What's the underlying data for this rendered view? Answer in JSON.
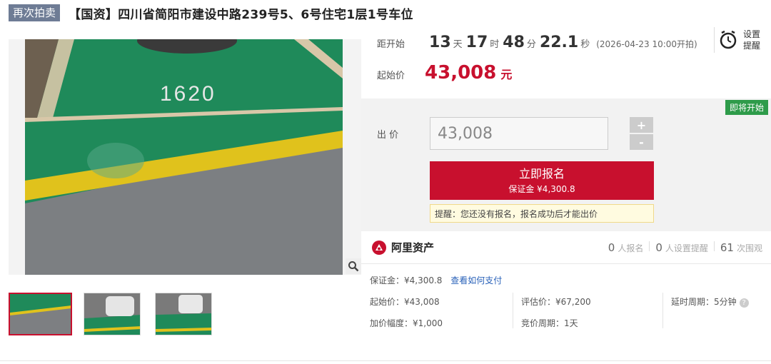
{
  "header": {
    "tag": "再次拍卖",
    "title": "【国资】四川省简阳市建设中路239号5、6号住宅1层1号车位"
  },
  "gallery": {
    "photo_text": "1620",
    "thumbnail_count": 3
  },
  "countdown": {
    "label": "距开始",
    "days": "13",
    "days_unit": "天",
    "hours": "17",
    "hours_unit": "时",
    "minutes": "48",
    "minutes_unit": "分",
    "seconds": "22.1",
    "seconds_unit": "秒",
    "start_note": "(2026-04-23 10:00开拍)"
  },
  "start_price": {
    "label": "起始价",
    "value": "43,008",
    "unit": "元"
  },
  "reminder": {
    "label": "设置提醒"
  },
  "bid": {
    "badge": "即将开始",
    "label": "出 价",
    "input_value": "43,008",
    "plus": "+",
    "minus": "-",
    "signup_label": "立即报名",
    "signup_sub": "保证金 ¥4,300.8",
    "tip": "提醒：您还没有报名，报名成功后才能出价"
  },
  "platform": {
    "name": "阿里资产",
    "stats": [
      {
        "num": "0",
        "label": "人报名"
      },
      {
        "num": "0",
        "label": "人设置提醒"
      },
      {
        "num": "61",
        "label": "次围观"
      }
    ]
  },
  "deposit": {
    "text": "保证金：¥4,300.8",
    "link": "查看如何支付"
  },
  "details": {
    "start_price": "起始价：¥43,008",
    "appraisal": "评估价：¥67,200",
    "delay": "延时周期：5分钟",
    "increment": "加价幅度：¥1,000",
    "bid_period": "竞价周期：1天"
  },
  "colors": {
    "accent_red": "#c8102e",
    "tag_bg": "#6e7c95",
    "badge_green": "#2e9b4a",
    "link_blue": "#2a62b9"
  }
}
